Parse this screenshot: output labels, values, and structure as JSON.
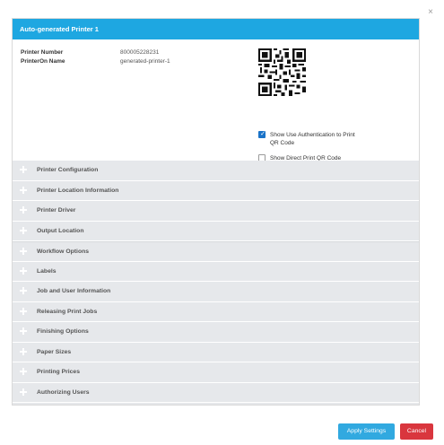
{
  "dialog": {
    "close_glyph": "×",
    "title": "Auto-generated Printer 1",
    "printer_number_label": "Printer Number",
    "printer_number_value": "800005228231",
    "printeron_name_label": "PrinterOn Name",
    "printeron_name_value": "generated-printer-1",
    "qr_icon": "qr-code-icon",
    "checkboxes": [
      {
        "label_line1": "Show Use Authentication to Print",
        "label_line2": "QR Code",
        "checked": true
      },
      {
        "label_line1": "Show Direct Print QR Code",
        "checked": false
      }
    ]
  },
  "sections": [
    {
      "label": "Printer Configuration"
    },
    {
      "label": "Printer Location Information"
    },
    {
      "label": "Printer Driver"
    },
    {
      "label": "Output Location"
    },
    {
      "label": "Workflow Options"
    },
    {
      "label": "Labels"
    },
    {
      "label": "Job and User Information"
    },
    {
      "label": "Releasing Print Jobs"
    },
    {
      "label": "Finishing Options"
    },
    {
      "label": "Paper Sizes"
    },
    {
      "label": "Printing Prices"
    },
    {
      "label": "Authorizing Users"
    }
  ],
  "footer": {
    "apply_label": "Apply Settings",
    "cancel_label": "Cancel"
  },
  "colors": {
    "header": "#1ea7e1",
    "apply": "#31a9e0",
    "cancel": "#d9363e",
    "section_bg": "#e6e8eb",
    "checkbox_checked": "#1a73c8"
  }
}
